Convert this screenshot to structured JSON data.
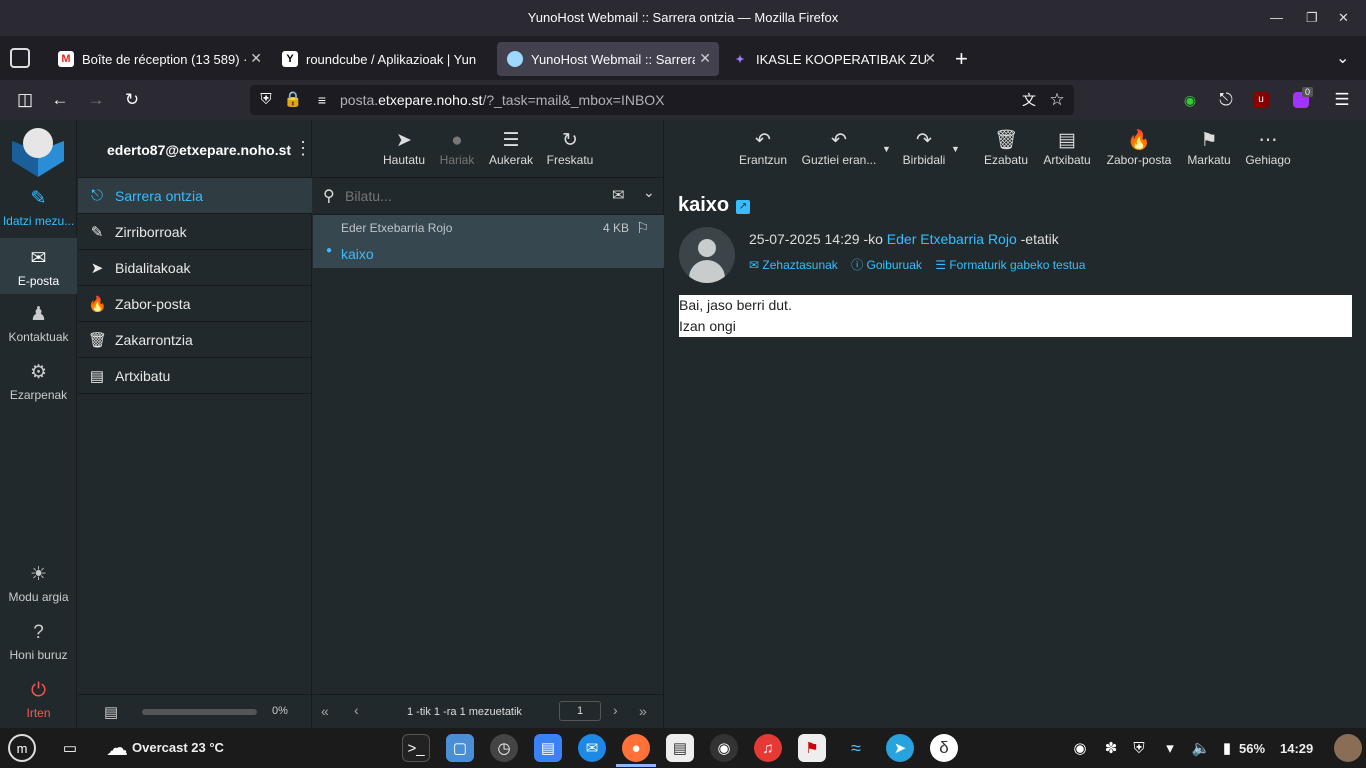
{
  "browser": {
    "window_title": "YunoHost Webmail :: Sarrera ontzia — Mozilla Firefox",
    "tabs": [
      {
        "label": "Boîte de réception (13 589) · ",
        "favicon": "gmail-icon"
      },
      {
        "label": "roundcube / Aplikazioak | Yun",
        "favicon": "yunohost-icon"
      },
      {
        "label": "YunoHost Webmail :: Sarrera",
        "favicon": "roundcube-icon"
      },
      {
        "label": "IKASLE KOOPERATIBAK ZUZ",
        "favicon": "ikasle-icon"
      }
    ],
    "url_prefix": "posta.",
    "url_host": "etxepare.noho.st",
    "url_rest": "/?_task=mail&_mbox=INBOX",
    "extension_badge": "0"
  },
  "app": {
    "account": "ederto87@etxepare.noho.st",
    "leftnav": [
      {
        "label": "Idatzi mezu...",
        "icon": "compose-icon"
      },
      {
        "label": "E-posta",
        "icon": "mail-icon"
      },
      {
        "label": "Kontaktuak",
        "icon": "contacts-icon"
      },
      {
        "label": "Ezarpenak",
        "icon": "settings-icon"
      }
    ],
    "leftnav_bottom": [
      {
        "label": "Modu argia",
        "icon": "light-mode-icon"
      },
      {
        "label": "Honi buruz",
        "icon": "help-icon"
      },
      {
        "label": "Irten",
        "icon": "power-icon"
      }
    ],
    "folders": [
      {
        "label": "Sarrera ontzia",
        "icon": "inbox-icon"
      },
      {
        "label": "Zirriborroak",
        "icon": "drafts-icon"
      },
      {
        "label": "Bidalitakoak",
        "icon": "sent-icon"
      },
      {
        "label": "Zabor-posta",
        "icon": "junk-icon"
      },
      {
        "label": "Zakarrontzia",
        "icon": "trash-icon"
      },
      {
        "label": "Artxibatu",
        "icon": "archive-icon"
      }
    ],
    "quota": "0%",
    "quota_fraction": 0,
    "list_toolbar": [
      "Hautatu",
      "Hariak",
      "Aukerak",
      "Freskatu"
    ],
    "search_placeholder": "Bilatu...",
    "messages": [
      {
        "from": "Eder Etxebarria Rojo",
        "size": "4 KB",
        "subject": "kaixo"
      }
    ],
    "pagination": {
      "text": "1 -tik 1 -ra 1 mezuetatik",
      "page": "1"
    },
    "read_toolbar": [
      "Erantzun",
      "Guztiei eran...",
      "Birbidali",
      "Ezabatu",
      "Artxibatu",
      "Zabor-posta",
      "Markatu",
      "Gehiago"
    ],
    "message": {
      "subject": "kaixo",
      "date": "25-07-2025 14:29",
      "ko": "-ko",
      "sender": "Eder Etxebarria Rojo",
      "etatik": "-etatik",
      "links": [
        "Zehaztasunak",
        "Goiburuak",
        "Formaturik gabeko testua"
      ],
      "body_line1": "Bai, jaso berri dut.",
      "body_line2": "Izan ongi"
    }
  },
  "taskbar": {
    "weather": "Overcast 23 °C",
    "battery": "56%",
    "clock": "14:29"
  },
  "colors": {
    "accent": "#37beff",
    "background": "#21292c",
    "danger": "#ff5552"
  }
}
